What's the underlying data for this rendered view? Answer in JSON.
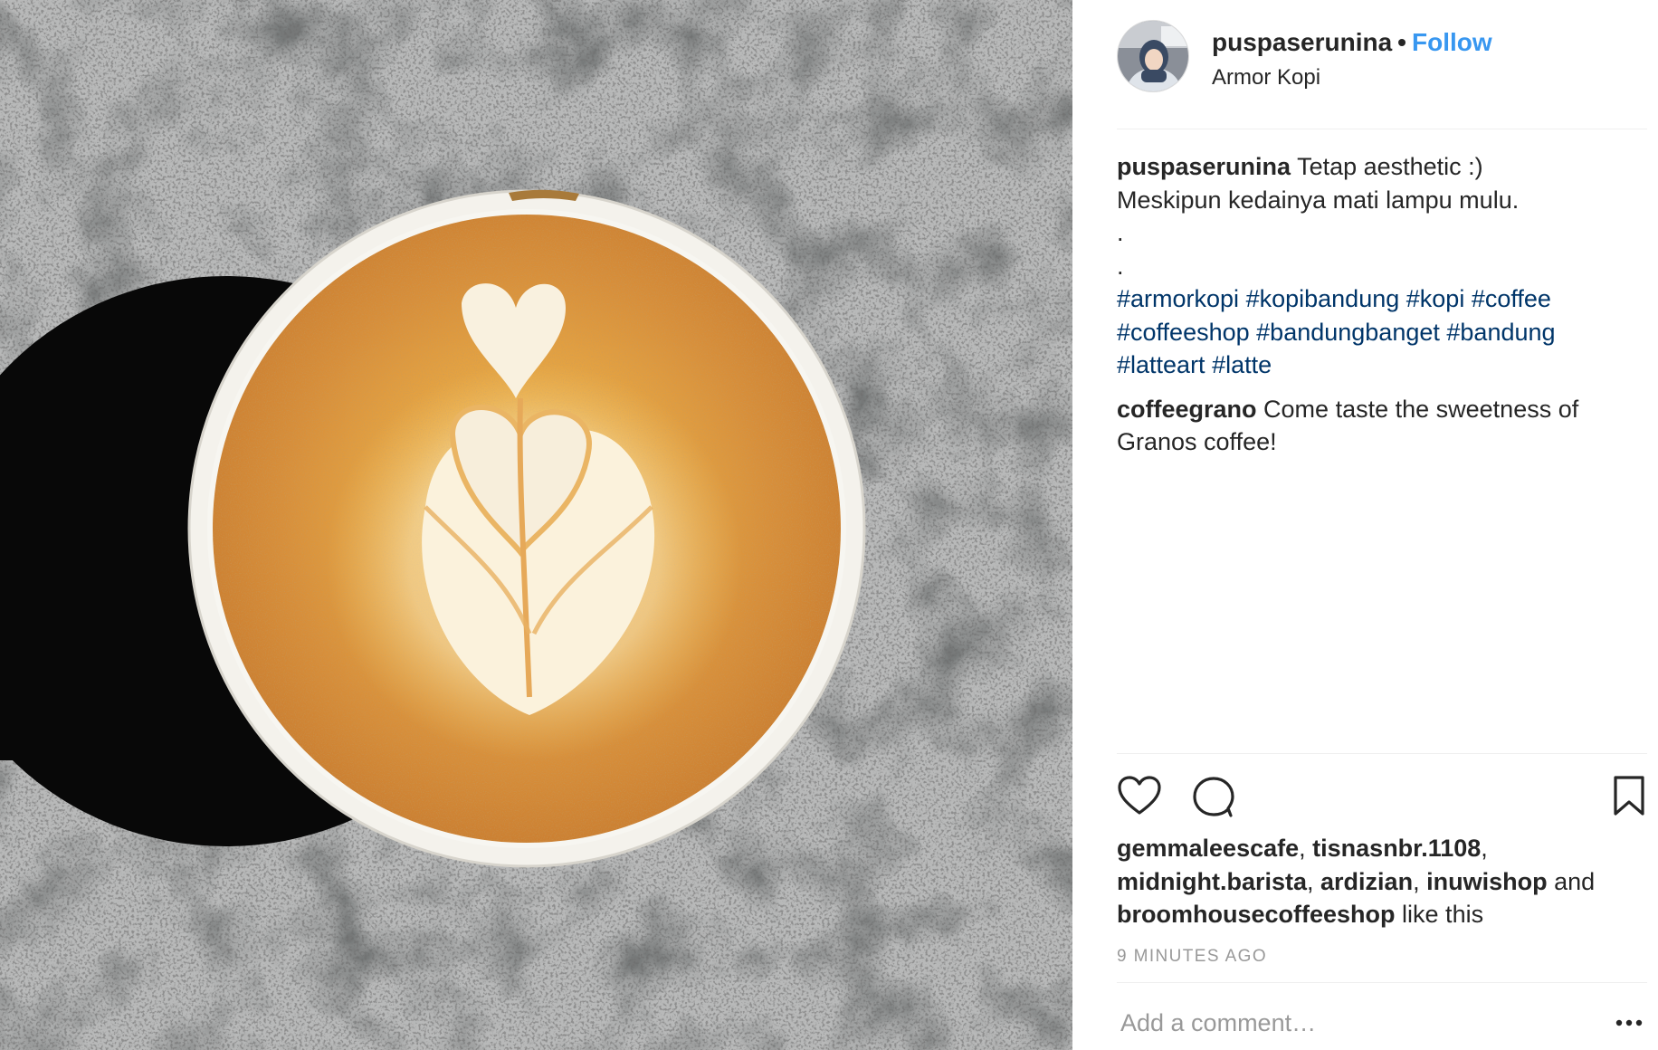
{
  "post": {
    "photo_alt": "",
    "user": {
      "username": "puspaserunina",
      "follow_label": "Follow",
      "location": "Armor Kopi"
    },
    "caption": {
      "author": "puspaserunina",
      "line1": "Tetap aesthetic :)",
      "line2": "Meskipun kedainya mati lampu mulu.",
      "dot1": ".",
      "dot2": ".",
      "hashtags": [
        "#armorkopi",
        "#kopibandung",
        "#kopi",
        "#coffee",
        "#coffeeshop",
        "#bandungbanget",
        "#bandung",
        "#latteart",
        "#latte"
      ]
    },
    "comment": {
      "author": "coffeegrano",
      "text": "Come taste the sweetness of Granos coffee!"
    },
    "likes": {
      "users": [
        "gemmaleescafe",
        "tisnasnbr.1108",
        "midnight.barista",
        "ardizian",
        "inuwishop"
      ],
      "and_label": "and",
      "last_user": "broomhousecoffeeshop",
      "suffix": "like this"
    },
    "timestamp": "9 MINUTES AGO",
    "add_comment_placeholder": "Add a comment…",
    "icons": {
      "like": "heart-icon",
      "comment": "comment-bubble-icon",
      "save": "bookmark-icon",
      "more": "more-options-icon"
    },
    "colors": {
      "link_blue": "#3897f0",
      "hashtag_blue": "#003569",
      "muted": "#999999",
      "text": "#262626"
    }
  }
}
